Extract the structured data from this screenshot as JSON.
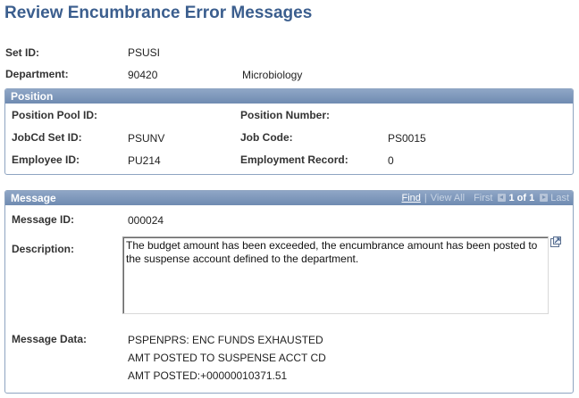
{
  "page": {
    "title": "Review Encumbrance Error Messages"
  },
  "header": {
    "set_id_label": "Set ID:",
    "set_id_value": "PSUSI",
    "department_label": "Department:",
    "department_value": "90420",
    "department_desc": "Microbiology"
  },
  "position": {
    "header": "Position",
    "pool_id_label": "Position Pool ID:",
    "pool_id_value": "",
    "position_number_label": "Position Number:",
    "position_number_value": "",
    "jobcd_setid_label": "JobCd Set ID:",
    "jobcd_setid_value": "PSUNV",
    "job_code_label": "Job Code:",
    "job_code_value": "PS0015",
    "employee_id_label": "Employee ID:",
    "employee_id_value": "PU214",
    "empl_record_label": "Employment Record:",
    "empl_record_value": "0"
  },
  "message": {
    "header": "Message",
    "nav": {
      "find": "Find",
      "separator": "|",
      "view_all": "View All",
      "first": "First",
      "count": "1 of 1",
      "last": "Last"
    },
    "message_id_label": "Message ID:",
    "message_id_value": "000024",
    "description_label": "Description:",
    "description_value": "The budget amount has been exceeded, the encumbrance amount has been posted to the suspense account defined to the department.",
    "message_data_label": "Message Data:",
    "message_data_lines": [
      "PSPENPRS: ENC FUNDS EXHAUSTED",
      "AMT POSTED TO SUSPENSE ACCT CD",
      "AMT POSTED:+00000010371.51"
    ]
  },
  "icons": {
    "expand": "expand-window-icon",
    "prev": "previous-arrow-icon",
    "next": "next-arrow-icon"
  },
  "colors": {
    "title": "#3b5e8e",
    "group_header": "#7d97bb",
    "group_border": "#8ea4c1"
  }
}
